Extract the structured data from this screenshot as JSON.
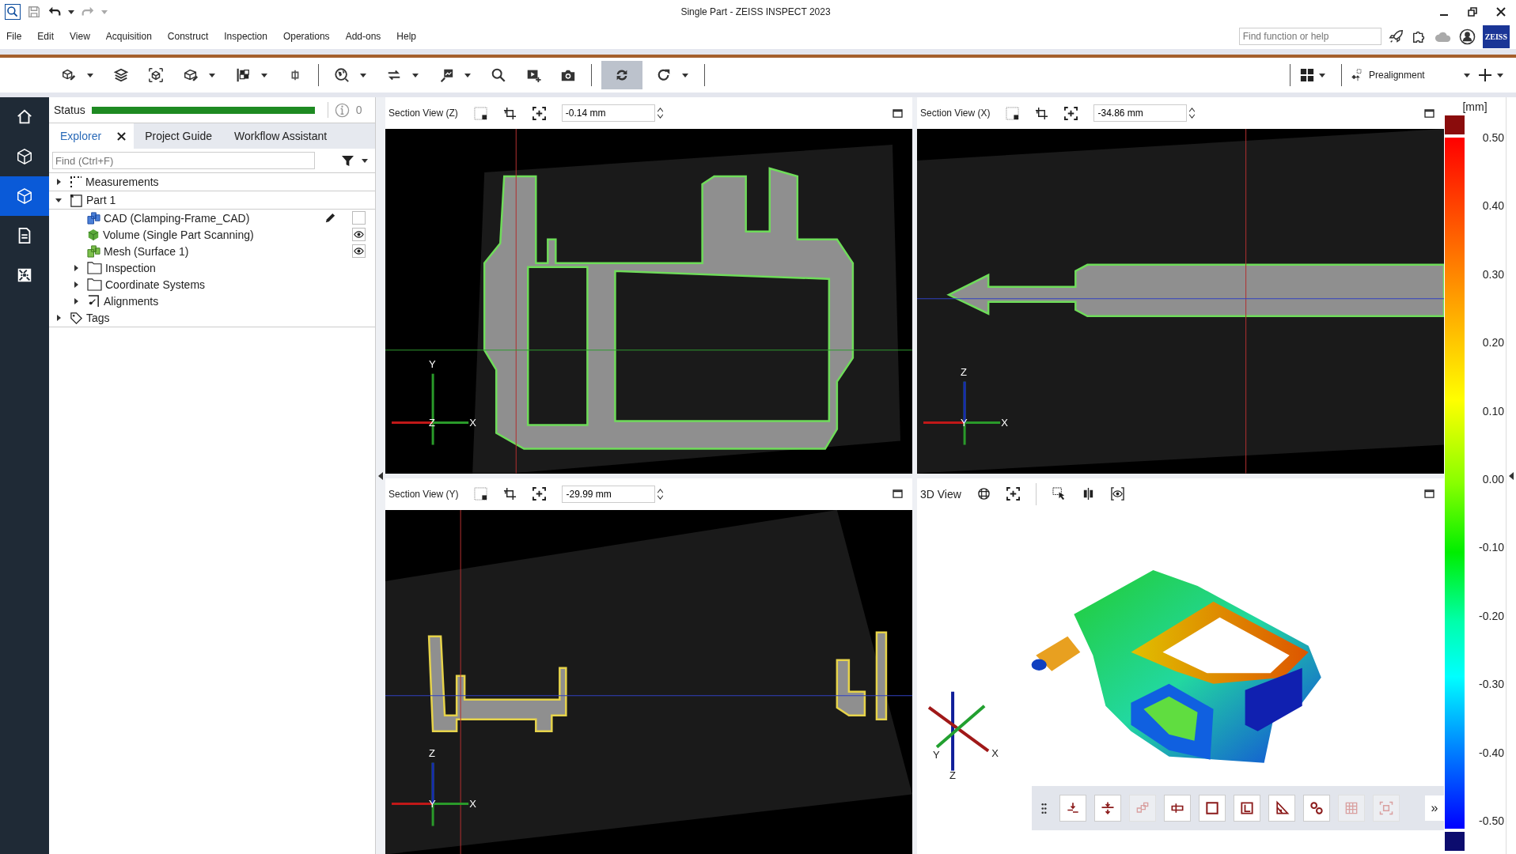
{
  "window": {
    "title": "Single Part - ZEISS INSPECT 2023"
  },
  "menu": [
    "File",
    "Edit",
    "View",
    "Acquisition",
    "Construct",
    "Inspection",
    "Operations",
    "Add-ons",
    "Help"
  ],
  "search": {
    "placeholder": "Find function or help"
  },
  "logo": "ZEISS",
  "toolbar": {
    "buttons": [
      {
        "kind": "cube-pencil",
        "dropdown": true,
        "selected": false
      },
      {
        "kind": "layers",
        "dropdown": false,
        "selected": false
      },
      {
        "kind": "cube-frame",
        "dropdown": false,
        "selected": false
      },
      {
        "kind": "box-pencil",
        "dropdown": true,
        "selected": false
      },
      {
        "kind": "checker",
        "dropdown": true,
        "selected": false
      },
      {
        "kind": "plug",
        "dropdown": false,
        "selected": false
      },
      {
        "kind": "globe",
        "dropdown": true,
        "selected": false
      },
      {
        "kind": "swap",
        "dropdown": true,
        "selected": false
      },
      {
        "kind": "flag",
        "dropdown": true,
        "selected": false
      },
      {
        "kind": "search",
        "dropdown": false,
        "selected": false
      },
      {
        "kind": "film",
        "dropdown": false,
        "selected": false
      },
      {
        "kind": "camera",
        "dropdown": false,
        "selected": false
      },
      {
        "kind": "sync",
        "dropdown": false,
        "selected": true
      },
      {
        "kind": "redo",
        "dropdown": true,
        "selected": false
      }
    ],
    "alignment": {
      "label": "Prealignment"
    }
  },
  "rail": [
    {
      "kind": "home",
      "selected": false
    },
    {
      "kind": "cube",
      "selected": false
    },
    {
      "kind": "cube",
      "selected": true
    },
    {
      "kind": "report",
      "selected": false
    },
    {
      "kind": "pattern",
      "selected": false
    }
  ],
  "status": {
    "label": "Status",
    "level": 1,
    "count": "0"
  },
  "tabs": [
    {
      "label": "Explorer",
      "selected": true,
      "closable": true
    },
    {
      "label": "Project Guide",
      "selected": false,
      "closable": false
    },
    {
      "label": "Workflow Assistant",
      "selected": false,
      "closable": false
    }
  ],
  "find": {
    "placeholder": "Find (Ctrl+F)"
  },
  "tree": [
    {
      "label": "Measurements",
      "kind": "measurements",
      "expanded": false
    },
    {
      "label": "Part 1",
      "kind": "part",
      "expanded": true,
      "children": [
        {
          "label": "CAD (Clamping-Frame_CAD)",
          "kind": "cad",
          "visible": false,
          "editable": true
        },
        {
          "label": "Volume (Single Part Scanning)",
          "kind": "volume",
          "visible": true
        },
        {
          "label": "Mesh (Surface 1)",
          "kind": "mesh",
          "visible": true
        },
        {
          "label": "Inspection",
          "kind": "folder",
          "expanded": false
        },
        {
          "label": "Coordinate Systems",
          "kind": "folder",
          "expanded": false
        },
        {
          "label": "Alignments",
          "kind": "alignment",
          "expanded": false
        }
      ]
    },
    {
      "label": "Tags",
      "kind": "tag",
      "expanded": false
    }
  ],
  "views": [
    {
      "kind": "section",
      "title": "Section View (Z)",
      "value": "-0.14 mm",
      "axes": [
        "Y",
        "Z",
        "X"
      ]
    },
    {
      "kind": "section",
      "title": "Section View (X)",
      "value": "-34.86 mm",
      "axes": [
        "Z",
        "Y",
        "X"
      ]
    },
    {
      "kind": "section",
      "title": "Section View (Y)",
      "value": "-29.99 mm",
      "axes": [
        "Z",
        "Y",
        "X"
      ]
    },
    {
      "kind": "model",
      "title": "3D View",
      "axes": [
        "Y",
        "X",
        "Z"
      ]
    }
  ],
  "floating_toolbar": {
    "buttons": [
      {
        "kind": "plane-down",
        "disabled": false
      },
      {
        "kind": "plane-split",
        "disabled": false
      },
      {
        "kind": "blocks",
        "disabled": true
      },
      {
        "kind": "slot",
        "disabled": false
      },
      {
        "kind": "square",
        "disabled": false
      },
      {
        "kind": "frame",
        "disabled": false
      },
      {
        "kind": "angle",
        "disabled": false
      },
      {
        "kind": "circles",
        "disabled": false
      },
      {
        "kind": "grid",
        "disabled": true
      },
      {
        "kind": "corners",
        "disabled": true
      }
    ],
    "more": "»"
  },
  "color_scale": {
    "unit": "[mm]",
    "ticks": [
      "0.50",
      "0.40",
      "0.30",
      "0.20",
      "0.10",
      "0.00",
      "-0.10",
      "-0.20",
      "-0.30",
      "-0.40",
      "-0.50"
    ]
  }
}
